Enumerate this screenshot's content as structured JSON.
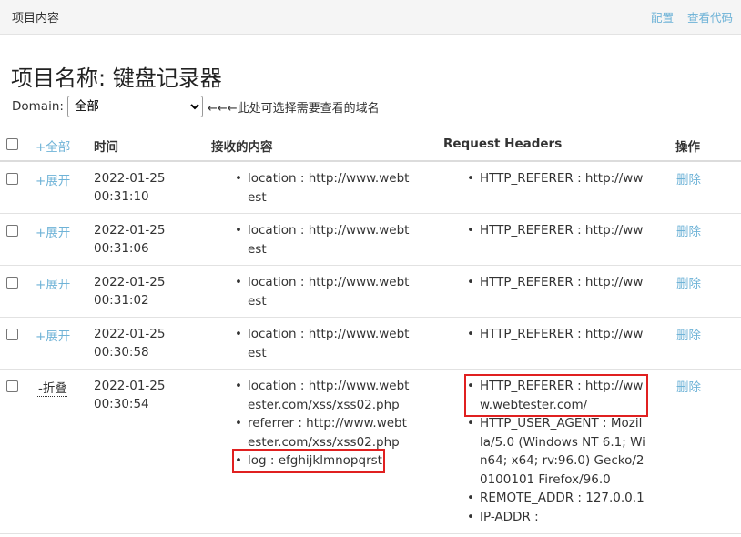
{
  "topbar": {
    "title": "项目内容",
    "config_link": "配置",
    "view_code_link": "查看代码"
  },
  "project_title": "项目名称: 键盘记录器",
  "domain": {
    "label": "Domain:",
    "selected": "全部",
    "hint": "←←←此处可选择需要查看的域名"
  },
  "table": {
    "headers": {
      "toggle_all": "+全部",
      "time": "时间",
      "content": "接收的内容",
      "request_headers": "Request Headers",
      "actions": "操作"
    },
    "rows": [
      {
        "toggle": "+展开",
        "date": "2022-01-25",
        "time": "00:31:10",
        "content": [
          "location : http://www.webtest"
        ],
        "headers": [
          "HTTP_REFERER : http://ww"
        ],
        "delete": "删除"
      },
      {
        "toggle": "+展开",
        "date": "2022-01-25",
        "time": "00:31:06",
        "content": [
          "location : http://www.webtest"
        ],
        "headers": [
          "HTTP_REFERER : http://ww"
        ],
        "delete": "删除"
      },
      {
        "toggle": "+展开",
        "date": "2022-01-25",
        "time": "00:31:02",
        "content": [
          "location : http://www.webtest"
        ],
        "headers": [
          "HTTP_REFERER : http://ww"
        ],
        "delete": "删除"
      },
      {
        "toggle": "+展开",
        "date": "2022-01-25",
        "time": "00:30:58",
        "content": [
          "location : http://www.webtest"
        ],
        "headers": [
          "HTTP_REFERER : http://ww"
        ],
        "delete": "删除"
      },
      {
        "toggle": "-折叠",
        "date": "2022-01-25",
        "time": "00:30:54",
        "content": [
          "location : http://www.webtester.com/xss/xss02.php",
          "referrer : http://www.webtester.com/xss/xss02.php",
          "log : efghijklmnopqrst"
        ],
        "headers": [
          "HTTP_REFERER : http://www.webtester.com/",
          "HTTP_USER_AGENT : Mozilla/5.0 (Windows NT 6.1; Win64; x64; rv:96.0) Gecko/20100101 Firefox/96.0",
          "REMOTE_ADDR : 127.0.0.1",
          "IP-ADDR :"
        ],
        "delete": "删除"
      }
    ]
  }
}
